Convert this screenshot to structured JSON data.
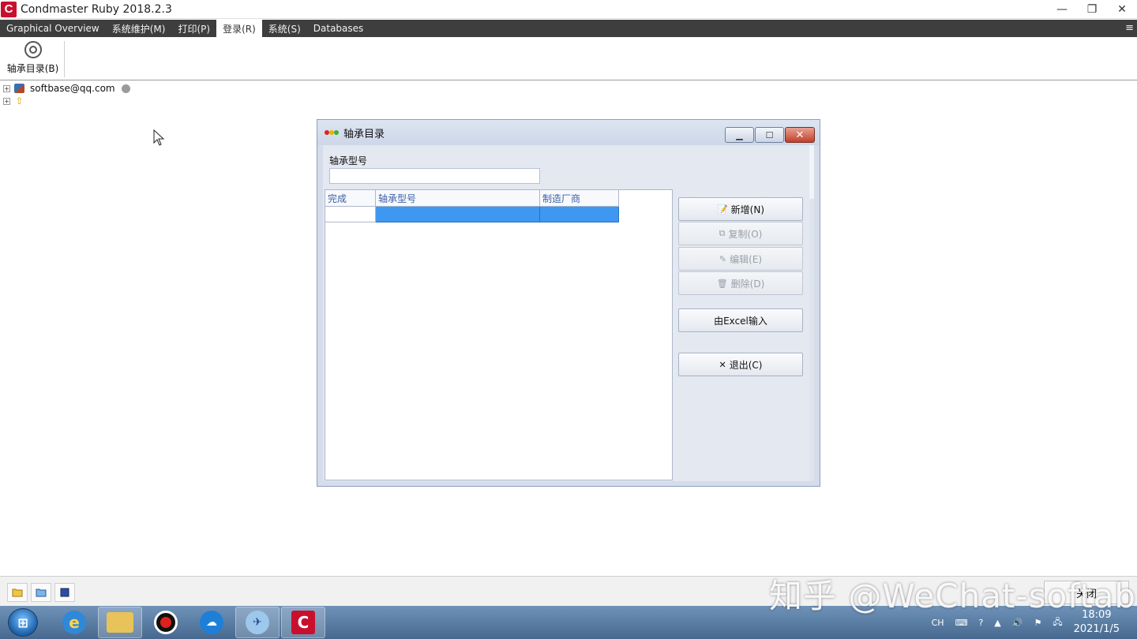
{
  "window": {
    "title": "Condmaster Ruby 2018.2.3",
    "logo_letter": "C",
    "minimize": "—",
    "restore": "❐",
    "close": "✕"
  },
  "menu": {
    "items": [
      {
        "label": "Graphical Overview"
      },
      {
        "label": "系统维护(M)"
      },
      {
        "label": "打印(P)"
      },
      {
        "label": "登录(R)",
        "active": true
      },
      {
        "label": "系统(S)"
      },
      {
        "label": "Databases"
      }
    ],
    "hamburger": "≡"
  },
  "ribbon": {
    "bearing_catalog_label": "轴承目录(B)"
  },
  "tree": {
    "user_label": "softbase@qq.com",
    "expander": "+"
  },
  "dialog": {
    "title": "轴承目录",
    "bearing_type_label": "轴承型号",
    "bearing_type_value": "",
    "columns": [
      "完成",
      "轴承型号",
      "制造厂商"
    ],
    "rows": [
      {
        "done": "",
        "type": "",
        "maker": ""
      }
    ],
    "buttons": {
      "new": "新增(N)",
      "copy": "复制(O)",
      "edit": "编辑(E)",
      "delete": "删除(D)",
      "excel": "由Excel输入",
      "exit": "退出(C)"
    },
    "title_dots": [
      "#d9261c",
      "#e8b400",
      "#3fae3a"
    ]
  },
  "bottom_strip": {
    "right_button": "关闭"
  },
  "taskbar": {
    "tray_lang": "CH",
    "time": "18:09",
    "date": "2021/1/5"
  },
  "watermark": "知乎 @WeChat-softab"
}
